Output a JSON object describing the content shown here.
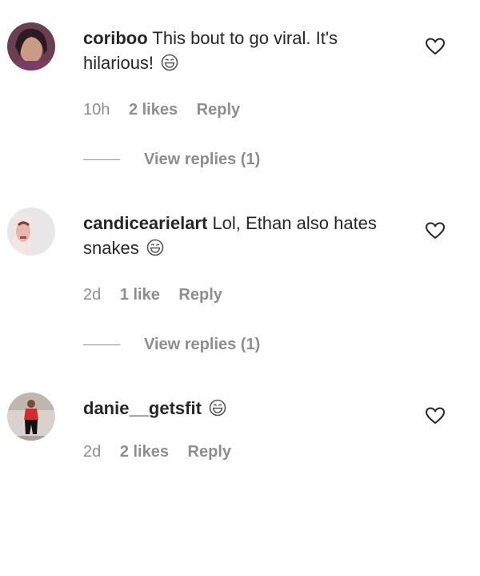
{
  "colors": {
    "text": "#262626",
    "meta": "#8e8e8e",
    "background": "#ffffff"
  },
  "comments": [
    {
      "username": "coriboo",
      "text": "This bout to go viral. It's hilarious!",
      "emoji": "laughing-emoji",
      "time": "10h",
      "likes": "2 likes",
      "reply": "Reply",
      "view_replies": "View replies (1)"
    },
    {
      "username": "candicearielart",
      "text": "Lol, Ethan also hates snakes",
      "emoji": "laughing-emoji",
      "time": "2d",
      "likes": "1 like",
      "reply": "Reply",
      "view_replies": "View replies (1)"
    },
    {
      "username": "danie__getsfit",
      "text": "",
      "emoji": "laughing-emoji",
      "time": "2d",
      "likes": "2 likes",
      "reply": "Reply"
    }
  ]
}
